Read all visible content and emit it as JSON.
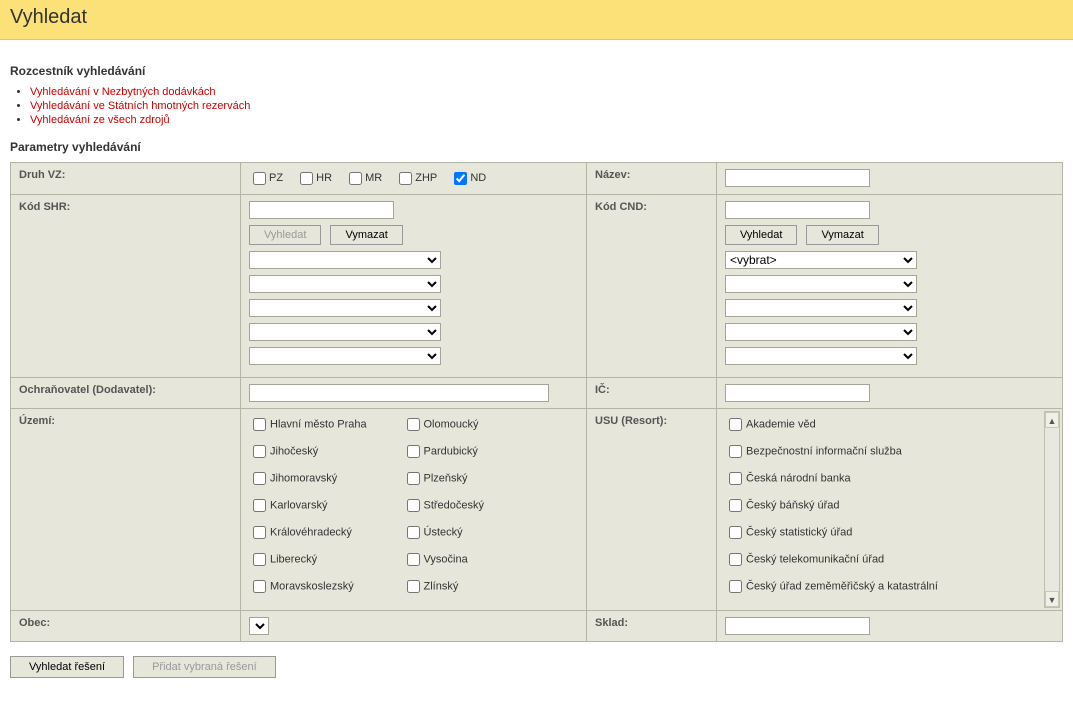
{
  "header": {
    "title": "Vyhledat"
  },
  "sections": {
    "rozcestnik_title": "Rozcestník vyhledávání",
    "links": [
      "Vyhledávání v Nezbytných dodávkách",
      "Vyhledávání ve Státních hmotných rezervách",
      "Vyhledávání ze všech zdrojů"
    ],
    "parametry_title": "Parametry vyhledávání"
  },
  "form": {
    "druh_vz": {
      "label": "Druh VZ:",
      "options": [
        {
          "label": "PZ",
          "checked": false
        },
        {
          "label": "HR",
          "checked": false
        },
        {
          "label": "MR",
          "checked": false
        },
        {
          "label": "ZHP",
          "checked": false
        },
        {
          "label": "ND",
          "checked": true
        }
      ]
    },
    "nazev_label": "Název:",
    "kod_shr": {
      "label": "Kód SHR:",
      "search_btn": "Vyhledat",
      "clear_btn": "Vymazat"
    },
    "kod_cnd": {
      "label": "Kód CND:",
      "search_btn": "Vyhledat",
      "clear_btn": "Vymazat",
      "select_placeholder": "<vybrat>"
    },
    "ochranovatel_label": "Ochraňovatel (Dodavatel):",
    "ic_label": "IČ:",
    "uzemi": {
      "label": "Území:",
      "col1": [
        "Hlavní město Praha",
        "Jihočeský",
        "Jihomoravský",
        "Karlovarský",
        "Královéhradecký",
        "Liberecký",
        "Moravskoslezský"
      ],
      "col2": [
        "Olomoucký",
        "Pardubický",
        "Plzeňský",
        "Středočeský",
        "Ústecký",
        "Vysočina",
        "Zlínský"
      ]
    },
    "usu": {
      "label": "USU (Resort):",
      "items": [
        "Akademie věd",
        "Bezpečnostní informační služba",
        "Česká národní banka",
        "Český báňský úřad",
        "Český statistický úřad",
        "Český telekomunikační úřad",
        "Český úřad zeměměřičský a katastrální"
      ]
    },
    "obec_label": "Obec:",
    "sklad_label": "Sklad:"
  },
  "buttons": {
    "search_solutions": "Vyhledat řešení",
    "add_selected": "Přidat vybraná řešení"
  }
}
